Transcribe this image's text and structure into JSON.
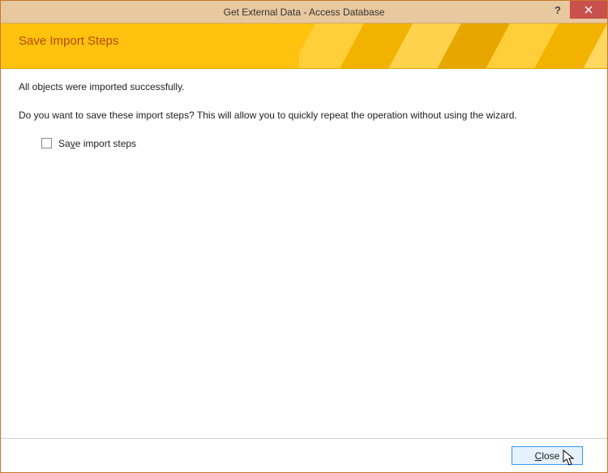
{
  "window": {
    "title": "Get External Data - Access Database"
  },
  "banner": {
    "title": "Save Import Steps"
  },
  "content": {
    "success_message": "All objects were imported successfully.",
    "prompt": "Do you want to save these import steps? This will allow you to quickly repeat the operation without using the wizard.",
    "checkbox": {
      "checked": false,
      "prefix": "Sa",
      "accel": "v",
      "suffix": "e import steps"
    }
  },
  "footer": {
    "close_accel": "C",
    "close_rest": "lose"
  }
}
